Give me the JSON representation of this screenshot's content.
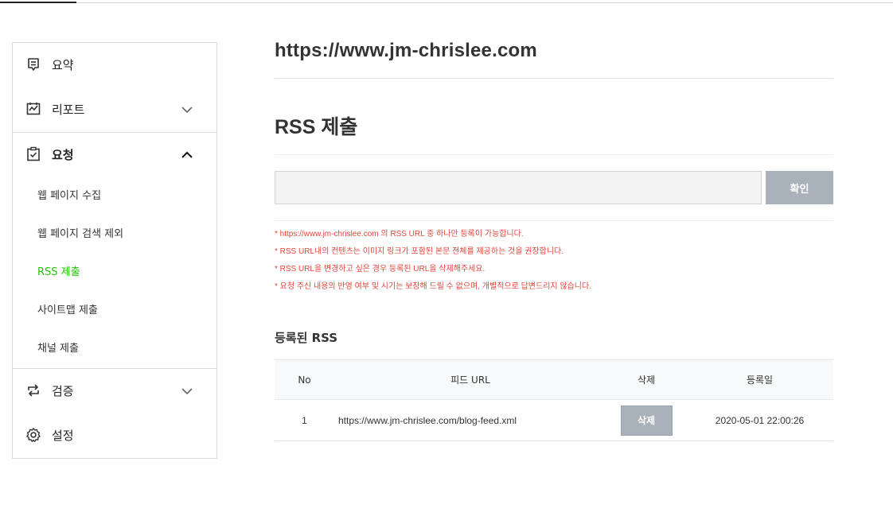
{
  "sidebar": {
    "summary_label": "요약",
    "report_label": "리포트",
    "request_label": "요청",
    "request_items": [
      "웹 페이지 수집",
      "웹 페이지 검색 제외",
      "RSS 제출",
      "사이트맵 제출",
      "채널 제출"
    ],
    "verify_label": "검증",
    "settings_label": "설정",
    "active_color": "#1ec800"
  },
  "main": {
    "site_url": "https://www.jm-chrislee.com",
    "section_title": "RSS 제출",
    "input_value": "",
    "confirm_label": "확인",
    "notices": [
      "* https://www.jm-chrislee.com 의 RSS URL 중 하나만 등록이 가능합니다.",
      "* RSS URL내의 컨텐츠는 이미지 링크가 포함된 본문 전체를 제공하는 것을 권장합니다.",
      "* RSS URL을 변경하고 싶은 경우 등록된 URL을 삭제해주세요.",
      "* 요청 주신 내용의 반영 여부 및 시기는 보장해 드릴 수 없으며, 개별적으로 답변드리지 않습니다."
    ],
    "notice_color": "#e5443a",
    "registered_title": "등록된 RSS",
    "table": {
      "headers": [
        "No",
        "피드 URL",
        "삭제",
        "등록일"
      ],
      "rows": [
        {
          "no": "1",
          "url": "https://www.jm-chrislee.com/blog-feed.xml",
          "delete_label": "삭제",
          "date": "2020-05-01 22:00:26"
        }
      ]
    }
  },
  "icons": {
    "summary": "summary-note-icon",
    "report": "report-chart-icon",
    "request": "clipboard-check-icon",
    "verify": "swap-arrows-icon",
    "settings": "gear-icon"
  }
}
